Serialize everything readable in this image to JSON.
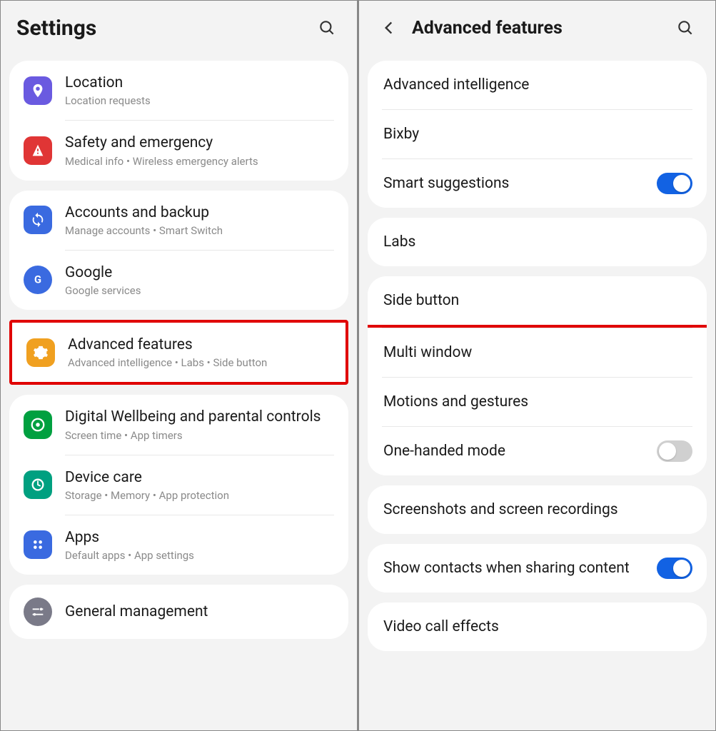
{
  "left": {
    "title": "Settings",
    "groups": [
      {
        "items": [
          {
            "title": "Location",
            "sub": "Location requests",
            "icon": "location",
            "color": "ic-purple"
          },
          {
            "title": "Safety and emergency",
            "sub": "Medical info  •  Wireless emergency alerts",
            "icon": "alert",
            "color": "ic-red"
          }
        ]
      },
      {
        "items": [
          {
            "title": "Accounts and backup",
            "sub": "Manage accounts  •  Smart Switch",
            "icon": "sync",
            "color": "ic-blue"
          },
          {
            "title": "Google",
            "sub": "Google services",
            "icon": "google",
            "color": "ic-bluecircle"
          }
        ]
      },
      {
        "items": [
          {
            "title": "Advanced features",
            "sub": "Advanced intelligence  •  Labs  •  Side button",
            "icon": "gear",
            "color": "ic-yellow",
            "highlighted": true
          }
        ]
      },
      {
        "items": [
          {
            "title": "Digital Wellbeing and parental controls",
            "sub": "Screen time  •  App timers",
            "icon": "wellbeing",
            "color": "ic-green"
          },
          {
            "title": "Device care",
            "sub": "Storage  •  Memory  •  App protection",
            "icon": "device",
            "color": "ic-teal"
          },
          {
            "title": "Apps",
            "sub": "Default apps  •  App settings",
            "icon": "apps",
            "color": "ic-blue3"
          }
        ]
      },
      {
        "items": [
          {
            "title": "General management",
            "sub": "",
            "icon": "sliders",
            "color": "ic-gray"
          }
        ]
      }
    ]
  },
  "right": {
    "title": "Advanced features",
    "groups": [
      {
        "items": [
          {
            "title": "Advanced intelligence"
          },
          {
            "title": "Bixby"
          },
          {
            "title": "Smart suggestions",
            "toggle": "on"
          }
        ]
      },
      {
        "items": [
          {
            "title": "Labs"
          }
        ]
      },
      {
        "items": [
          {
            "title": "Side button",
            "highlighted": true
          },
          {
            "title": "Multi window"
          },
          {
            "title": "Motions and gestures"
          },
          {
            "title": "One-handed mode",
            "toggle": "off"
          }
        ]
      },
      {
        "items": [
          {
            "title": "Screenshots and screen recordings"
          }
        ]
      },
      {
        "items": [
          {
            "title": "Show contacts when sharing content",
            "toggle": "on"
          }
        ]
      },
      {
        "items": [
          {
            "title": "Video call effects"
          }
        ]
      }
    ]
  }
}
